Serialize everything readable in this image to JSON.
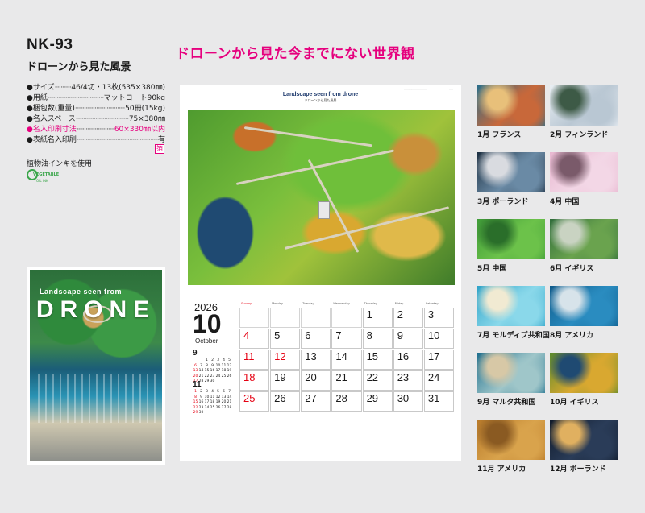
{
  "product": {
    "code": "NK-93",
    "subtitle": "ドローンから見た風景",
    "headline": "ドローンから見た今までにない世界観"
  },
  "specs": [
    {
      "key": "●サイズ",
      "value": "46/4切・13枚(535×380㎜)",
      "highlight": false
    },
    {
      "key": "●用紙",
      "value": "マットコート90kg",
      "highlight": false
    },
    {
      "key": "●梱包数(重量)",
      "value": "50冊(15kg)",
      "highlight": false
    },
    {
      "key": "●名入スペース",
      "value": "75×380㎜",
      "highlight": false
    },
    {
      "key": "●名入印刷寸法",
      "value": "60×330㎜以内",
      "highlight": true
    },
    {
      "key": "●表紙名入印刷",
      "value": "有",
      "highlight": false
    }
  ],
  "badge": "箔",
  "ink_note": "植物油インキを使用",
  "veg_logo": {
    "line1": "VEGETABLE",
    "line2": "OIL INK"
  },
  "cover": {
    "tagline": "Landscape seen from",
    "title": "DRONE"
  },
  "sheet": {
    "photo_title": "Landscape seen from drone",
    "photo_subtitle": "ドローンから見た風景",
    "year": "2026",
    "month_number": "10",
    "month_name": "October",
    "weekdays": [
      "Sunday",
      "Monday",
      "Tuesday",
      "Wednesday",
      "Thursday",
      "Friday",
      "Saturday"
    ],
    "days": [
      [
        "",
        "",
        "",
        "",
        "1",
        "2",
        "3"
      ],
      [
        "4",
        "5",
        "6",
        "7",
        "8",
        "9",
        "10"
      ],
      [
        "11",
        "12",
        "13",
        "14",
        "15",
        "16",
        "17"
      ],
      [
        "18",
        "19",
        "20",
        "21",
        "22",
        "23",
        "24"
      ],
      [
        "25",
        "26",
        "27",
        "28",
        "29",
        "30",
        "31"
      ]
    ],
    "holiday_days": [
      "12"
    ],
    "mini_months": [
      {
        "label": "9",
        "days": [
          "",
          "",
          "1",
          "2",
          "3",
          "4",
          "5",
          "6",
          "7",
          "8",
          "9",
          "10",
          "11",
          "12",
          "13",
          "14",
          "15",
          "16",
          "17",
          "18",
          "19",
          "20",
          "21",
          "22",
          "23",
          "24",
          "25",
          "26",
          "27",
          "28",
          "29",
          "30",
          "",
          "",
          ""
        ]
      },
      {
        "label": "11",
        "days": [
          "1",
          "2",
          "3",
          "4",
          "5",
          "6",
          "7",
          "8",
          "9",
          "10",
          "11",
          "12",
          "13",
          "14",
          "15",
          "16",
          "17",
          "18",
          "19",
          "20",
          "21",
          "22",
          "23",
          "24",
          "25",
          "26",
          "27",
          "28",
          "29",
          "30",
          "",
          "",
          "",
          "",
          ""
        ]
      }
    ]
  },
  "thumbnails": [
    {
      "caption": "1月 フランス",
      "colors": [
        "#2a6e8a",
        "#c8683a",
        "#e8c07a"
      ]
    },
    {
      "caption": "2月 フィンランド",
      "colors": [
        "#e9eef3",
        "#b9c7d3",
        "#3d5a46"
      ]
    },
    {
      "caption": "3月 ポーランド",
      "colors": [
        "#1d3042",
        "#6a8aa5",
        "#d9dbe0"
      ]
    },
    {
      "caption": "4月 中国",
      "colors": [
        "#e8b7d0",
        "#f3d7e6",
        "#7a5a6a"
      ]
    },
    {
      "caption": "5月 中国",
      "colors": [
        "#3f9b38",
        "#6cc24a",
        "#2a6e2a"
      ]
    },
    {
      "caption": "6月 イギリス",
      "colors": [
        "#2f6c3a",
        "#6aa34e",
        "#c9d3c2"
      ]
    },
    {
      "caption": "7月 モルディブ共和国",
      "colors": [
        "#2fa3c8",
        "#8ad8ea",
        "#f1ead2"
      ]
    },
    {
      "caption": "8月 アメリカ",
      "colors": [
        "#0e5a8a",
        "#2a8cc0",
        "#d7e3ea"
      ]
    },
    {
      "caption": "9月 マルタ共和国",
      "colors": [
        "#1f6f8e",
        "#9fc6c9",
        "#d7c8a6"
      ]
    },
    {
      "caption": "10月 イギリス",
      "colors": [
        "#5a8a2c",
        "#d9a830",
        "#1f4a72"
      ]
    },
    {
      "caption": "11月 アメリカ",
      "colors": [
        "#b87a2a",
        "#d9a34c",
        "#8a5a22"
      ]
    },
    {
      "caption": "12月 ポーランド",
      "colors": [
        "#101a2a",
        "#2a3c58",
        "#e0b060"
      ]
    }
  ]
}
